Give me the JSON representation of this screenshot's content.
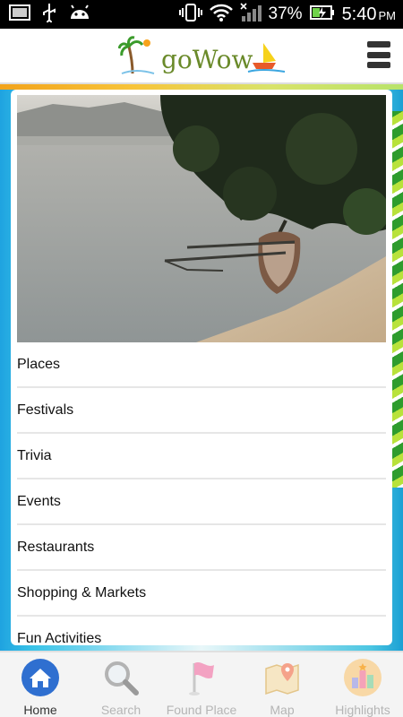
{
  "status_bar": {
    "battery_percent": "37%",
    "time": "5:40",
    "ampm": "PM"
  },
  "header": {
    "app_name": "goWow"
  },
  "menu": {
    "items": [
      "Places",
      "Festivals",
      "Trivia",
      "Events",
      "Restaurants",
      "Shopping & Markets",
      "Fun Activities"
    ]
  },
  "tabs": [
    {
      "label": "Home",
      "icon": "home-icon",
      "active": true
    },
    {
      "label": "Search",
      "icon": "search-icon",
      "active": false
    },
    {
      "label": "Found Place",
      "icon": "flag-icon",
      "active": false
    },
    {
      "label": "Map",
      "icon": "map-icon",
      "active": false
    },
    {
      "label": "Highlights",
      "icon": "highlights-icon",
      "active": false
    }
  ],
  "colors": {
    "home_icon_bg": "#2f6fd0",
    "battery_fill": "#6fd24a",
    "logo_orange": "#e97b2a"
  }
}
